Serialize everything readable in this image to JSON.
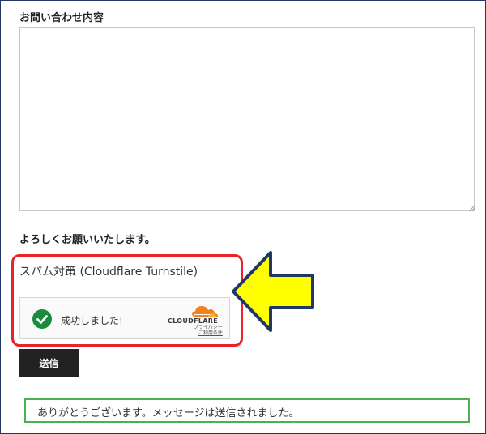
{
  "form": {
    "contact_label": "お問い合わせ内容",
    "message_value": "",
    "closing_note": "よろしくお願いいたします。",
    "spam_title": "スパム対策 (Cloudflare Turnstile)",
    "submit_label": "送信"
  },
  "turnstile": {
    "status": "成功しました!",
    "brand": "CLOUDFLARE",
    "privacy": "プライバシー",
    "terms": "ご利用条件",
    "check_color": "#1a8a3c",
    "brand_color": "#f48120"
  },
  "result": {
    "message": "ありがとうございます。メッセージは送信されました。"
  },
  "annotation": {
    "highlight_color": "#e8232a",
    "arrow_fill": "#ffff00",
    "arrow_stroke": "#1f3864"
  }
}
